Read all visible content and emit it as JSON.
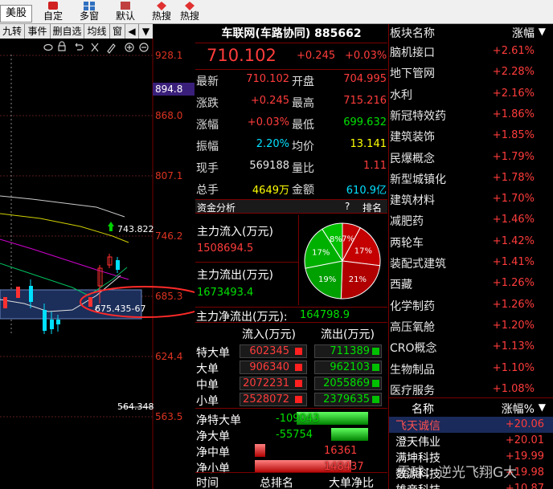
{
  "toolbar": {
    "stock_tab": "美股",
    "buttons": [
      "自定",
      "多窗",
      "默认",
      "热搜",
      "热搜"
    ]
  },
  "chart": {
    "tabs": [
      "九转",
      "事件",
      "删自选",
      "均线",
      "窗"
    ],
    "price_labels": [
      "928.1",
      "894.8",
      "868.0",
      "807.1",
      "746.2",
      "685.3",
      "624.4",
      "563.5"
    ],
    "max_marker": "743.822",
    "min_marker": "564.348",
    "range_label": "675.435-67"
  },
  "quote": {
    "title": "车联网(车路协同) 885662",
    "price": "710.102",
    "change": "+0.245",
    "change_pct": "+0.03%",
    "rows": [
      {
        "l1": "最新",
        "v1": "710.102",
        "l2": "开盘",
        "v2": "704.995"
      },
      {
        "l1": "涨跌",
        "v1": "+0.245",
        "l2": "最高",
        "v2": "715.216"
      },
      {
        "l1": "涨幅",
        "v1": "+0.03%",
        "l2": "最低",
        "v2": "699.632"
      },
      {
        "l1": "振幅",
        "v1": "2.20%",
        "l2": "均价",
        "v2": "13.141"
      },
      {
        "l1": "现手",
        "v1": "569188",
        "l2": "量比",
        "v2": "1.11"
      },
      {
        "l1": "总手",
        "v1": "4649万",
        "l2": "金额",
        "v2": "610.9亿"
      }
    ],
    "fund_header": "资金分析",
    "fund_help": "?",
    "fund_rank": "排名",
    "inflow_label": "主力流入(万元)",
    "inflow_value": "1508694.5",
    "outflow_label": "主力流出(万元)",
    "outflow_value": "1673493.4",
    "net_label": "主力净流出(万元):",
    "net_value": "164798.9",
    "pie": [
      {
        "label": "7%",
        "value": 7,
        "color": "#c40000"
      },
      {
        "label": "17%",
        "value": 17,
        "color": "#c40000"
      },
      {
        "label": "21%",
        "value": 21,
        "color": "#b00000"
      },
      {
        "label": "19%",
        "value": 19,
        "color": "#00a000"
      },
      {
        "label": "17%",
        "value": 17,
        "color": "#00b000"
      },
      {
        "label": "8%",
        "value": 8,
        "color": "#00c000"
      }
    ],
    "flow_head_in": "流入(万元)",
    "flow_head_out": "流出(万元)",
    "flows": [
      {
        "label": "特大单",
        "in": "602345",
        "out": "711389"
      },
      {
        "label": "大单",
        "in": "906340",
        "out": "962103"
      },
      {
        "label": "中单",
        "in": "2072231",
        "out": "2055869"
      },
      {
        "label": "小单",
        "in": "2528072",
        "out": "2379635"
      }
    ],
    "nets": [
      {
        "label": "净特大单",
        "value": "-109043",
        "frac": -0.74
      },
      {
        "label": "净大单",
        "value": "-55754",
        "frac": -0.38
      },
      {
        "label": "净中单",
        "value": "16361",
        "frac": 0.11
      },
      {
        "label": "净小单",
        "value": "148437",
        "frac": 1.0
      }
    ],
    "footer": [
      "时间",
      "总排名",
      "大单净比"
    ]
  },
  "sectors": {
    "head_name": "板块名称",
    "head_pct": "涨幅",
    "items": [
      {
        "name": "脑机接口",
        "pct": "+2.61%"
      },
      {
        "name": "地下管网",
        "pct": "+2.28%"
      },
      {
        "name": "水利",
        "pct": "+2.16%"
      },
      {
        "name": "新冠特效药",
        "pct": "+1.86%"
      },
      {
        "name": "建筑装饰",
        "pct": "+1.85%"
      },
      {
        "name": "民爆概念",
        "pct": "+1.79%"
      },
      {
        "name": "新型城镇化",
        "pct": "+1.78%"
      },
      {
        "name": "建筑材料",
        "pct": "+1.70%"
      },
      {
        "name": "减肥药",
        "pct": "+1.46%"
      },
      {
        "name": "两轮车",
        "pct": "+1.42%"
      },
      {
        "name": "装配式建筑",
        "pct": "+1.41%"
      },
      {
        "name": "西藏",
        "pct": "+1.26%"
      },
      {
        "name": "化学制药",
        "pct": "+1.26%"
      },
      {
        "name": "高压氧舱",
        "pct": "+1.20%"
      },
      {
        "name": "CRO概念",
        "pct": "+1.13%"
      },
      {
        "name": "生物制品",
        "pct": "+1.10%"
      },
      {
        "name": "医疗服务",
        "pct": "+1.08%"
      }
    ],
    "stock_head_name": "名称",
    "stock_head_pct": "涨幅%",
    "stocks": [
      {
        "name": "飞天诚信",
        "pct": "+20.06"
      },
      {
        "name": "澄天伟业",
        "pct": "+20.01"
      },
      {
        "name": "满坤科技",
        "pct": "+19.99"
      },
      {
        "name": "数源科技",
        "pct": "+19.98"
      },
      {
        "name": "雄帝科技",
        "pct": "+10.87"
      }
    ],
    "watermark": "雪球：逆光飞翔G大"
  }
}
